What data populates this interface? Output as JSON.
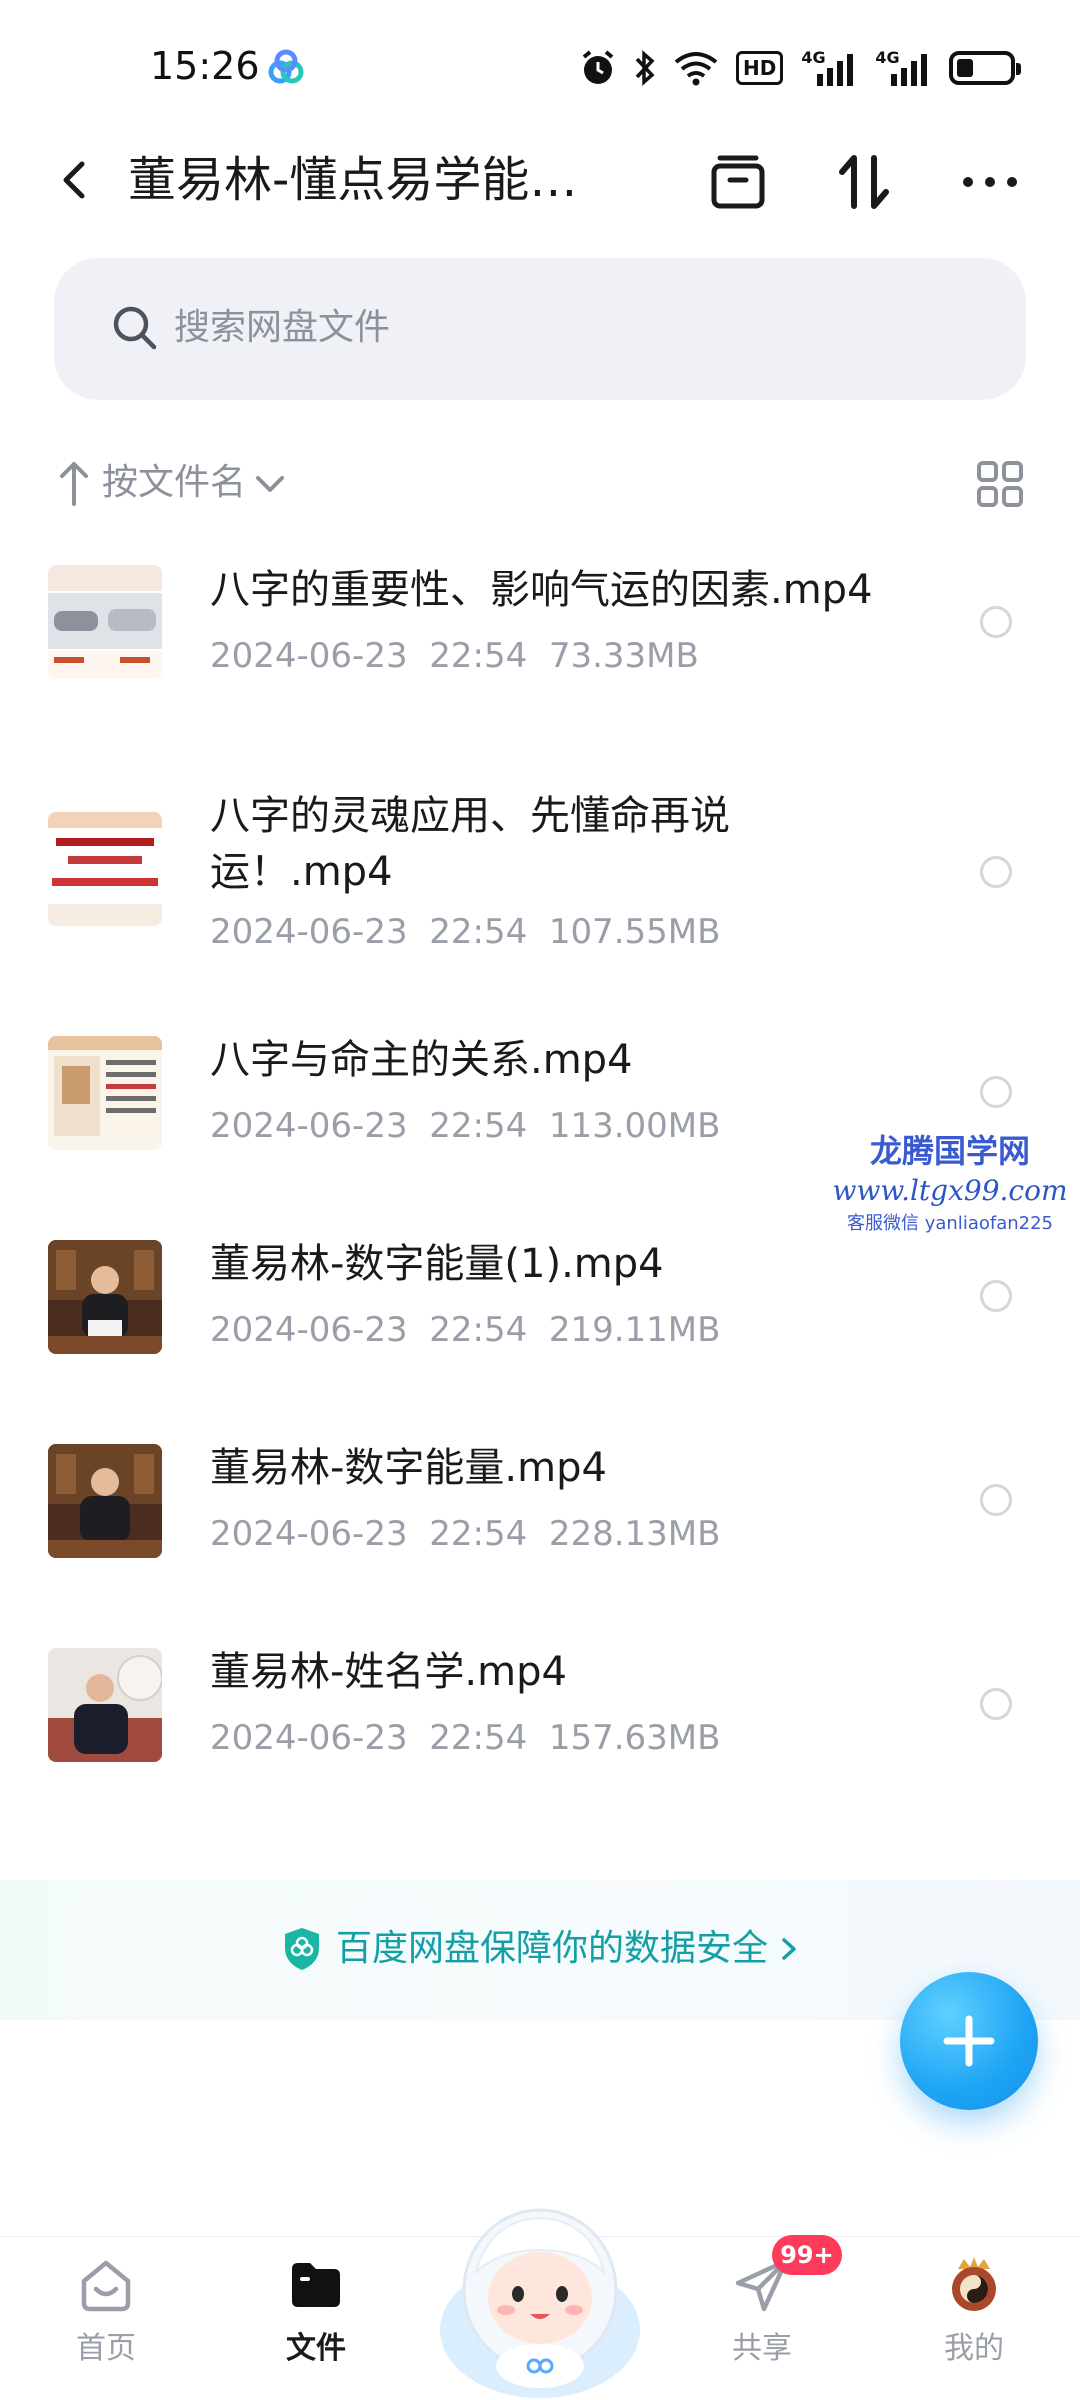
{
  "status_bar": {
    "time": "15:26",
    "hd_label": "HD",
    "net1": "4G",
    "net2": "4G",
    "icons": [
      "app-icon",
      "alarm-icon",
      "bluetooth-icon",
      "wifi-icon",
      "hd-icon",
      "signal-icon",
      "signal-icon",
      "battery-icon"
    ]
  },
  "header": {
    "title": "董易林-懂点易学能…",
    "icons": [
      "back-icon",
      "inbox-icon",
      "sort-arrows-icon",
      "more-icon"
    ]
  },
  "search": {
    "placeholder": "搜索网盘文件"
  },
  "sort": {
    "label": "按文件名"
  },
  "files": [
    {
      "name": "八字的重要性、影响气运的因素.mp4",
      "date": "2024-06-23",
      "time": "22:54",
      "size": "73.33MB"
    },
    {
      "name": "八字的灵魂应用、先懂命再说运！.mp4",
      "name_line1": "八字的灵魂应用、先懂命再说",
      "name_line2": "运！.mp4",
      "date": "2024-06-23",
      "time": "22:54",
      "size": "107.55MB"
    },
    {
      "name": "八字与命主的关系.mp4",
      "date": "2024-06-23",
      "time": "22:54",
      "size": "113.00MB"
    },
    {
      "name": "董易林-数字能量(1).mp4",
      "date": "2024-06-23",
      "time": "22:54",
      "size": "219.11MB"
    },
    {
      "name": "董易林-数字能量.mp4",
      "date": "2024-06-23",
      "time": "22:54",
      "size": "228.13MB"
    },
    {
      "name": "董易林-姓名学.mp4",
      "date": "2024-06-23",
      "time": "22:54",
      "size": "157.63MB"
    }
  ],
  "watermark": {
    "line1": "龙腾国学网",
    "line2": "www.ltgx99.com",
    "line3": "客服微信 yanliaofan225"
  },
  "banner": {
    "text": "百度网盘保障你的数据安全"
  },
  "bottom_nav": {
    "items": [
      {
        "label": "首页"
      },
      {
        "label": "文件"
      },
      {
        "label": "共享"
      },
      {
        "label": "我的"
      }
    ],
    "share_badge": "99+"
  },
  "colors": {
    "accent": "#1ea4f5",
    "banner_text": "#12a0a6",
    "badge": "#ff3b5c",
    "secondary_text": "#9a9ea8",
    "search_bg": "#eff1f6"
  }
}
